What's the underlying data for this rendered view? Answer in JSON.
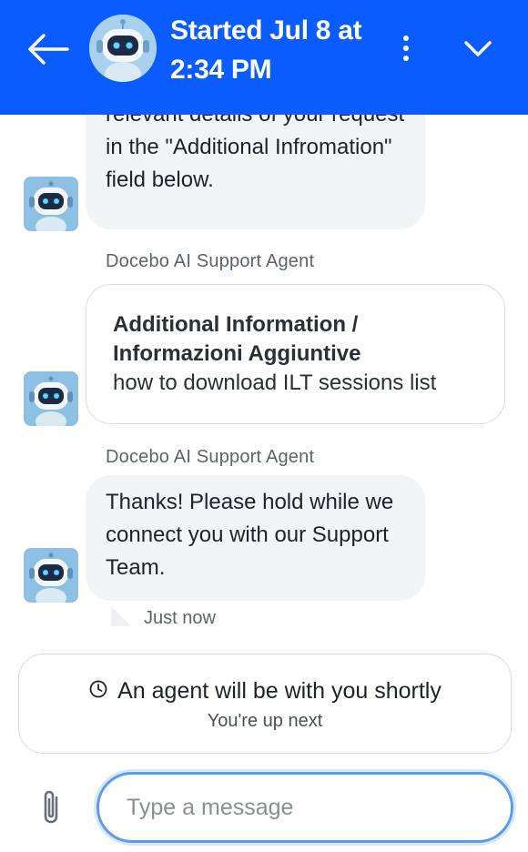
{
  "header": {
    "title": "Started Jul 8 at 2:34 PM",
    "avatar_badge": "Docebo",
    "colors": {
      "background": "#0a5cff",
      "foreground": "#ffffff"
    },
    "icons": {
      "back": "arrow-left-icon",
      "menu": "vertical-dots-icon",
      "collapse": "chevron-down-icon"
    }
  },
  "messages": [
    {
      "type": "bot_text",
      "text": "relevant details of your request in the \"Additional Infromation\" field below."
    },
    {
      "type": "bot_card",
      "sender": "Docebo AI Support Agent",
      "title": "Additional Information / Informazioni Aggiuntive",
      "value": "how to download ILT sessions list"
    },
    {
      "type": "bot_text",
      "sender": "Docebo AI Support Agent",
      "text": "Thanks! Please hold while we connect you  with our Support Team.",
      "timestamp": "Just now"
    }
  ],
  "status": {
    "icon": "clock-icon",
    "primary": "An agent will be with you shortly",
    "secondary": "You're up next"
  },
  "composer": {
    "placeholder": "Type a message",
    "value": "",
    "attach_icon": "paperclip-icon",
    "focus_color": "#5b9bf0"
  }
}
